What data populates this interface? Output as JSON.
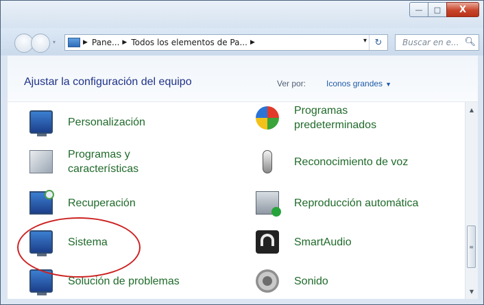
{
  "window": {
    "buttons": {
      "minimize": "—",
      "maximize": "□",
      "close": "X"
    }
  },
  "nav": {
    "breadcrumb": [
      "Pane...",
      "Todos los elementos de Pa..."
    ],
    "separator": "▶",
    "dropdown_glyph": "▾",
    "refresh_glyph": "↻",
    "search_placeholder": "Buscar en e..."
  },
  "header": {
    "title": "Ajustar la configuración del equipo",
    "view_label": "Ver por:",
    "view_value": "Iconos grandes",
    "view_caret": "▼"
  },
  "items": [
    {
      "label": "Personalización",
      "icon": "personalization-icon"
    },
    {
      "label": "Programas\npredeterminados",
      "icon": "default-programs-icon"
    },
    {
      "label": "Programas y\ncaracterísticas",
      "icon": "programs-features-icon"
    },
    {
      "label": "Reconocimiento de voz",
      "icon": "speech-recognition-icon"
    },
    {
      "label": "Recuperación",
      "icon": "recovery-icon"
    },
    {
      "label": "Reproducción automática",
      "icon": "autoplay-icon"
    },
    {
      "label": "Sistema",
      "icon": "system-icon"
    },
    {
      "label": "SmartAudio",
      "icon": "smartaudio-icon"
    },
    {
      "label": "Solución de problemas",
      "icon": "troubleshooting-icon"
    },
    {
      "label": "Sonido",
      "icon": "sound-icon"
    }
  ],
  "scrollbar": {
    "up": "▲",
    "down": "▼",
    "grip": "≡"
  }
}
